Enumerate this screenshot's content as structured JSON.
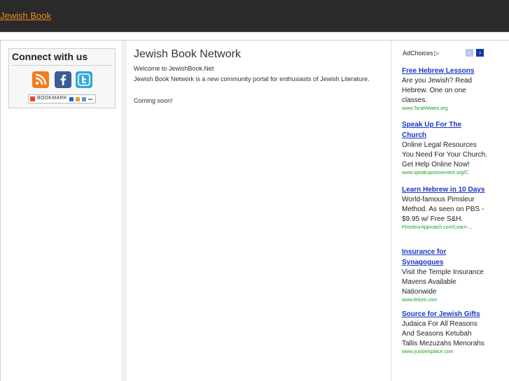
{
  "header": {
    "site_title": "Jewish Book"
  },
  "sidebar": {
    "connect_title": "Connect with us",
    "social_icons": [
      "rss-icon",
      "facebook-icon",
      "twitter-icon"
    ],
    "bookmark_label": "BOOKMARK"
  },
  "main": {
    "title": "Jewish Book Network",
    "welcome": "Welcome to JewishBook.Net",
    "description": "Jewish Book Network is a new community portal for enthusiasts of Jewish Literature.",
    "coming_soon": "Coming soon!"
  },
  "ads": {
    "adchoices_label": "AdChoices",
    "items": [
      {
        "title": "Free Hebrew Lessons",
        "body": "Are you Jewish? Read Hebrew. One on one classes.",
        "url": "www.TorahMates.org"
      },
      {
        "title": "Speak Up For The Church",
        "body": "Online Legal Resources You Need For Your Church. Get Help Online Now!",
        "url": "www.speakupmovement.org/C"
      },
      {
        "title": "Learn Hebrew in 10 Days",
        "body": "World-famous Pimsleur Method. As seen on PBS - $9.95 w/ Free S&H.",
        "url": "PimsleurApproach.com/Learn-..."
      },
      {
        "title": "Insurance for Synagogues",
        "body": "Visit the Temple Insurance Mavens Available Nationwide",
        "url": "www.felsen.com"
      },
      {
        "title": "Source for Jewish Gifts",
        "body": "Judaica For All Reasons And Seasons Ketubah Tallis Mezuzahs Menorahs",
        "url": "www.yussieisplace.com"
      }
    ]
  },
  "colors": {
    "header_bg": "#2a2a2a",
    "site_title": "#f08a1c",
    "ad_link": "#1a35c8",
    "ad_url": "#19a119"
  }
}
